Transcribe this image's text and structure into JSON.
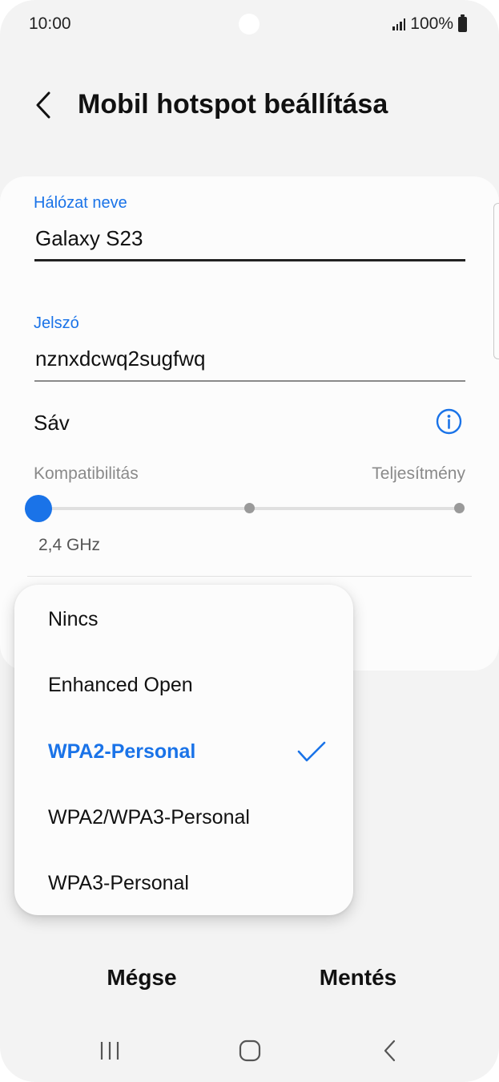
{
  "status_bar": {
    "time": "10:00",
    "battery": "100%"
  },
  "header": {
    "title": "Mobil hotspot beállítása"
  },
  "network_name": {
    "label": "Hálózat neve",
    "value": "Galaxy S23"
  },
  "password": {
    "label": "Jelszó",
    "value": "nznxdcwq2sugfwq"
  },
  "band": {
    "label": "Sáv",
    "left_label": "Kompatibilitás",
    "right_label": "Teljesítmény",
    "selected_value": "2,4 GHz",
    "position": 0
  },
  "security_dropdown": {
    "options": [
      {
        "label": "Nincs",
        "selected": false
      },
      {
        "label": "Enhanced Open",
        "selected": false
      },
      {
        "label": "WPA2-Personal",
        "selected": true
      },
      {
        "label": "WPA2/WPA3-Personal",
        "selected": false
      },
      {
        "label": "WPA3-Personal",
        "selected": false
      }
    ]
  },
  "actions": {
    "cancel": "Mégse",
    "save": "Mentés"
  },
  "colors": {
    "accent": "#1a73e8",
    "background": "#f3f3f3",
    "card": "#fcfcfc"
  },
  "icons": {
    "back": "back-arrow-icon",
    "info": "info-icon",
    "check": "check-icon",
    "nav_recent": "recent-apps-icon",
    "nav_home": "home-icon",
    "nav_back": "nav-back-icon"
  }
}
